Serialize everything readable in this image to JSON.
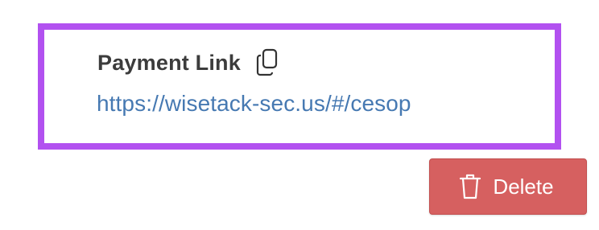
{
  "payment": {
    "label": "Payment Link",
    "url": "https://wisetack-sec.us/#/cesop"
  },
  "actions": {
    "delete_label": "Delete"
  },
  "icons": {
    "copy": "copy-icon",
    "trash": "trash-icon"
  },
  "colors": {
    "highlight_border": "#b251f0",
    "link": "#4679b2",
    "delete_bg": "#d66060",
    "label_text": "#3c3c3c"
  }
}
